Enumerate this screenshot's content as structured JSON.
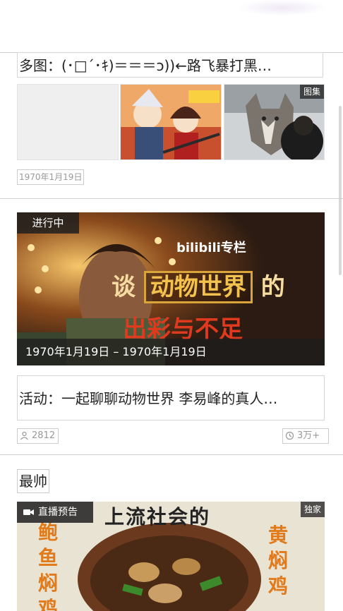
{
  "card1": {
    "title": "多图：(･□´･ｷ)＝＝＝ɔ))←路飞暴打黑…",
    "gallery_badge": "图集",
    "date": "1970年1月19日"
  },
  "card2": {
    "status": "进行中",
    "date_range": "1970年1月19日 – 1970年1月19日",
    "banner_brand": "bilibili专栏",
    "banner_line1_prefix": "谈",
    "banner_line1_main": "动物世界",
    "banner_line1_suffix": "的",
    "banner_line2": "出彩与不足",
    "title": "活动：一起聊聊动物世界 李易峰的真人…",
    "participants": "2812",
    "views": "3万+"
  },
  "card3": {
    "section_title": "最帅",
    "live_badge": "直播预告",
    "exclusive_badge": "独家",
    "image_top_text": "上流社会的",
    "image_left_text": "鲍鱼焖鸡",
    "image_right_text": "黄焖鸡"
  },
  "colors": {
    "badge_bg": "#1e1e1e",
    "border": "#cccccc",
    "banner_gold": "#f2c14e",
    "banner_red": "#e03a1e"
  },
  "icons": {
    "participants": "person-icon",
    "views": "clock-icon",
    "live": "camera-icon"
  }
}
